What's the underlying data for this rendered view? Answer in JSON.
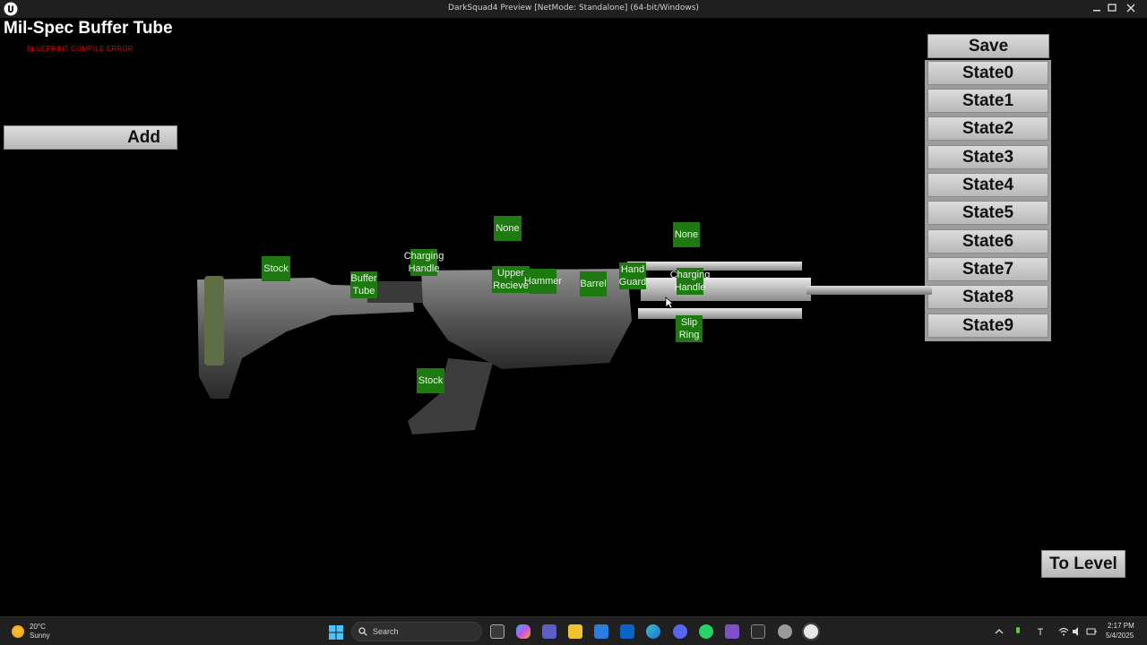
{
  "window": {
    "title": "DarkSquad4 Preview [NetMode: Standalone]  (64-bit/Windows)"
  },
  "overlay": {
    "item_title": "Mil-Spec Buffer Tube",
    "compile_error": "BLUEPRINT COMPILE ERROR",
    "add_label": "Add",
    "save_label": "Save",
    "to_level_label": "To Level"
  },
  "states": [
    "State0",
    "State1",
    "State2",
    "State3",
    "State4",
    "State5",
    "State6",
    "State7",
    "State8",
    "State9"
  ],
  "part_labels": [
    {
      "text": "None"
    },
    {
      "text": "None"
    },
    {
      "text": "Stock"
    },
    {
      "text": "Charging\nHandle"
    },
    {
      "text": "Buffer\nTube"
    },
    {
      "text": "Upper\nRecieve"
    },
    {
      "text": "Hammer"
    },
    {
      "text": "Barrel"
    },
    {
      "text": "Hand\nGuard"
    },
    {
      "text": "Charging\nHandle"
    },
    {
      "text": "Slip\nRing"
    },
    {
      "text": "Stock"
    }
  ],
  "taskbar": {
    "weather_temp": "20°C",
    "weather_condition": "Sunny",
    "search_placeholder": "Search",
    "time": "2:17 PM",
    "date": "5/4/2025",
    "apps": [
      "task-view",
      "copilot",
      "teams",
      "file-explorer",
      "store",
      "outlook",
      "edge",
      "discord",
      "whatsapp",
      "visual-studio",
      "epic-games",
      "chrome-canary",
      "unreal-engine"
    ]
  },
  "colors": {
    "label_green": "#1e7a10",
    "error_red": "#dd0000",
    "button_gray": "#c8c8c8"
  }
}
